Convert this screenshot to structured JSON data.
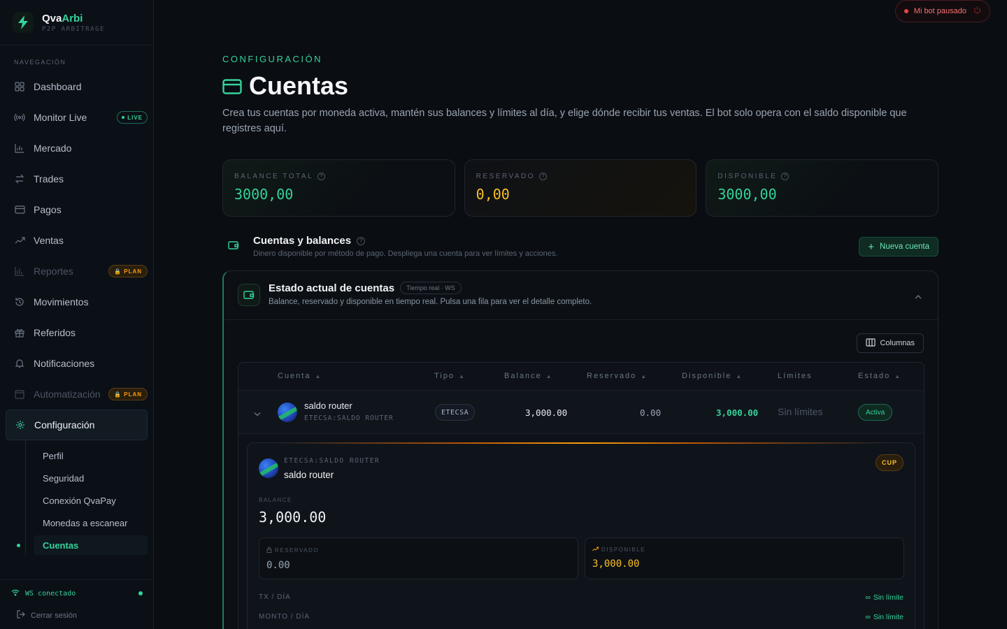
{
  "brand": {
    "name_a": "Qva",
    "name_b": "Arbi",
    "tagline": "P2P ARBITRAGE"
  },
  "nav": {
    "section": "NAVEGACIÓN",
    "items": [
      {
        "label": "Dashboard",
        "icon": "grid-icon"
      },
      {
        "label": "Monitor Live",
        "icon": "radio-icon",
        "badge": "LIVE"
      },
      {
        "label": "Mercado",
        "icon": "chart-icon"
      },
      {
        "label": "Trades",
        "icon": "swap-icon"
      },
      {
        "label": "Pagos",
        "icon": "card-icon"
      },
      {
        "label": "Ventas",
        "icon": "trend-icon"
      },
      {
        "label": "Reportes",
        "icon": "bar-icon",
        "badge": "PLAN"
      },
      {
        "label": "Movimientos",
        "icon": "history-icon"
      },
      {
        "label": "Referidos",
        "icon": "gift-icon"
      },
      {
        "label": "Notificaciones",
        "icon": "bell-icon"
      },
      {
        "label": "Automatización",
        "icon": "calendar-icon",
        "badge": "PLAN"
      },
      {
        "label": "Configuración",
        "icon": "gear-icon"
      }
    ],
    "sub": [
      "Perfil",
      "Seguridad",
      "Conexión QvaPay",
      "Monedas a escanear",
      "Cuentas"
    ]
  },
  "footer": {
    "ws": "WS conectado",
    "logout": "Cerrar sesión"
  },
  "bot_status": "Mi bot pausado",
  "page": {
    "eyebrow": "CONFIGURACIÓN",
    "title": "Cuentas",
    "description": "Crea tus cuentas por moneda activa, mantén sus balances y límites al día, y elige dónde recibir tus ventas. El bot solo opera con el saldo disponible que registres aquí."
  },
  "stats": [
    {
      "label": "BALANCE TOTAL",
      "value": "3000,00"
    },
    {
      "label": "RESERVADO",
      "value": "0,00"
    },
    {
      "label": "DISPONIBLE",
      "value": "3000,00"
    }
  ],
  "section": {
    "title": "Cuentas y balances",
    "subtitle": "Dinero disponible por método de pago. Despliega una cuenta para ver límites y acciones.",
    "new_button": "Nueva cuenta"
  },
  "panel": {
    "title": "Estado actual de cuentas",
    "pill": "Tiempo real · WS",
    "subtitle": "Balance, reservado y disponible en tiempo real. Pulsa una fila para ver el detalle completo.",
    "columns_button": "Columnas"
  },
  "table": {
    "headers": [
      "Cuenta",
      "Tipo",
      "Balance",
      "Reservado",
      "Disponible",
      "Límites",
      "Estado"
    ],
    "rows": [
      {
        "name": "saldo router",
        "code": "ETECSA:SALDO ROUTER",
        "tipo": "ETECSA",
        "balance": "3,000.00",
        "reservado": "0.00",
        "disponible": "3,000.00",
        "limites": "Sin límites",
        "estado": "Activa"
      }
    ]
  },
  "detail": {
    "code": "ETECSA:SALDO ROUTER",
    "name": "saldo router",
    "currency": "CUP",
    "balance_label": "BALANCE",
    "balance": "3,000.00",
    "reservado_label": "RESERVADO",
    "reservado": "0.00",
    "disponible_label": "DISPONIBLE",
    "disponible": "3,000.00",
    "tx_label": "TX / DÍA",
    "tx_value": "Sin límite",
    "monto_label": "MONTO / DÍA",
    "monto_value": "Sin límite"
  },
  "colors": {
    "accent": "#34d399",
    "warning": "#fbbf24",
    "danger": "#ef4444"
  }
}
